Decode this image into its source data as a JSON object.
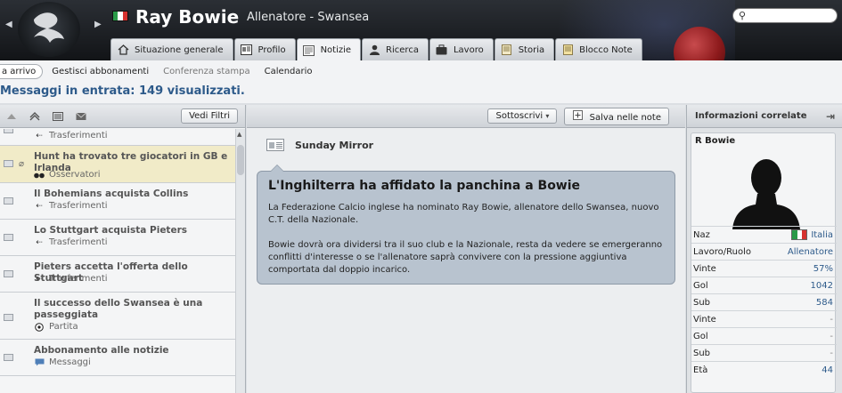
{
  "header": {
    "title": "Ray Bowie",
    "subtitle": "Allenatore - Swansea",
    "search_placeholder": ""
  },
  "tabs": [
    {
      "label": "Situazione generale",
      "icon": "home-icon"
    },
    {
      "label": "Profilo",
      "icon": "profile-icon"
    },
    {
      "label": "Notizie",
      "icon": "news-icon",
      "active": true
    },
    {
      "label": "Ricerca",
      "icon": "person-search-icon"
    },
    {
      "label": "Lavoro",
      "icon": "briefcase-icon"
    },
    {
      "label": "Storia",
      "icon": "history-icon"
    },
    {
      "label": "Blocco Note",
      "icon": "notepad-icon"
    }
  ],
  "subnav": {
    "inbox": "a arrivo",
    "subscriptions": "Gestisci abbonamenti",
    "press": "Conferenza stampa",
    "calendar": "Calendario"
  },
  "inbox_title": "Messaggi in entrata: 149 visualizzati.",
  "left": {
    "filter_button": "Vedi Filtri",
    "items": [
      {
        "headline": "",
        "category": "Trasferimenti",
        "icon": "transfer-arrows-icon"
      },
      {
        "headline": "Hunt ha trovato tre giocatori in GB e Irlanda",
        "category": "Osservatori",
        "icon": "binoculars-icon",
        "selected": true
      },
      {
        "headline": "Il Bohemians acquista Collins",
        "category": "Trasferimenti",
        "icon": "transfer-arrows-icon"
      },
      {
        "headline": "Lo Stuttgart acquista Pieters",
        "category": "Trasferimenti",
        "icon": "transfer-arrows-icon"
      },
      {
        "headline": "Pieters accetta l'offerta dello Stuttgart",
        "category": "Trasferimenti",
        "icon": "transfer-arrows-icon"
      },
      {
        "headline": "Il successo dello Swansea è una passeggiata",
        "category": "Partita",
        "icon": "football-icon"
      },
      {
        "headline": "Abbonamento alle notizie",
        "category": "Messaggi",
        "icon": "message-icon"
      }
    ]
  },
  "center": {
    "subscribe_button": "Sottoscrivi",
    "save_button": "Salva nelle note",
    "source": "Sunday Mirror",
    "headline": "L'Inghilterra ha affidato la panchina a Bowie",
    "paragraph1": "La Federazione Calcio inglese ha nominato Ray Bowie, allenatore dello Swansea, nuovo C.T. della Nazionale.",
    "paragraph2": "Bowie dovrà ora dividersi tra il suo club e la Nazionale, resta da vedere se emergeranno conflitti d'interesse o se l'allenatore saprà convivere con la pressione aggiuntiva comportata dal doppio incarico."
  },
  "right": {
    "title": "Informazioni correlate",
    "person_name": "R Bowie",
    "rows": [
      {
        "label": "Naz",
        "value": "Italia",
        "flag": true
      },
      {
        "label": "Lavoro/Ruolo",
        "value": "Allenatore"
      },
      {
        "label": "Vinte",
        "value": "57%"
      },
      {
        "label": "Gol",
        "value": "1042"
      },
      {
        "label": "Sub",
        "value": "584"
      },
      {
        "label": "Vinte",
        "value": "-"
      },
      {
        "label": "Gol",
        "value": "-"
      },
      {
        "label": "Sub",
        "value": "-"
      },
      {
        "label": "Età",
        "value": "44"
      }
    ]
  },
  "colors": {
    "accent_blue": "#2d5a8a",
    "bubble": "#b8c3cf",
    "selected_row": "#f1ebc8",
    "flag_green": "#2a9a48",
    "flag_red": "#d6322f"
  }
}
